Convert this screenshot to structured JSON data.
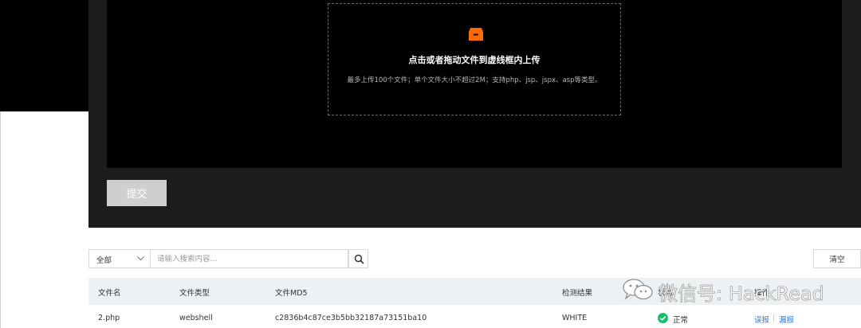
{
  "upload": {
    "title": "点击或者拖动文件到虚线框内上传",
    "hint": "最多上传100个文件；单个文件大小不超过2M；支持php、jsp、jspx、asp等类型。",
    "icon": "inbox-icon",
    "icon_color": "#ff6a00"
  },
  "actions": {
    "submit_label": "提交"
  },
  "filter": {
    "selected": "全部",
    "search_placeholder": "请输入搜索内容...",
    "clear_label": "清空"
  },
  "table": {
    "columns": [
      "文件名",
      "文件类型",
      "文件MD5",
      "检测结果",
      "状态",
      "操作"
    ],
    "rows": [
      {
        "name": "2.php",
        "type": "webshell",
        "md5": "c2836b4c87ce3b5bb32187a73151ba10",
        "result": "WHITE",
        "status": "正常",
        "action_misreport": "误报",
        "action_missreport": "漏报"
      }
    ]
  },
  "watermark": {
    "text": "微信号: HackRead"
  },
  "colors": {
    "status_ok": "#19be6b",
    "link": "#2a7ad6"
  }
}
